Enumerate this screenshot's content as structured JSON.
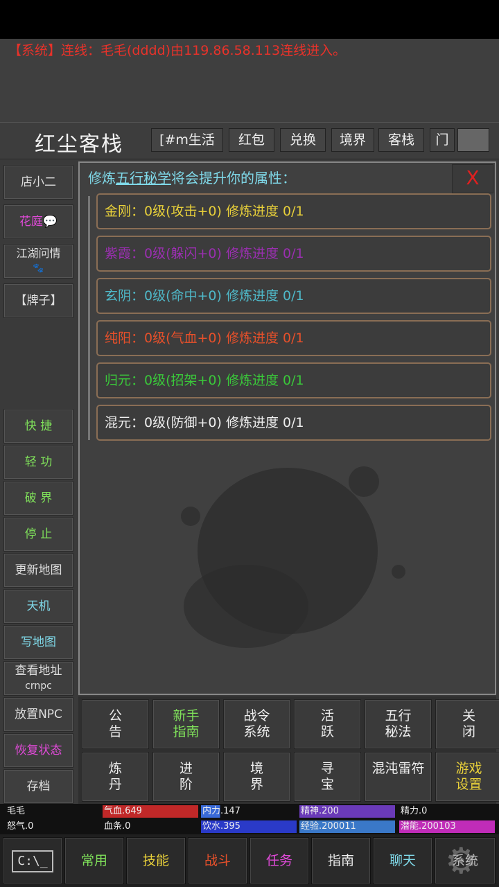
{
  "system_message": "【系统】连线：毛毛(dddd)由119.86.58.113连线进入。",
  "room": {
    "name": "红尘客栈",
    "buttons": [
      "[#m生活",
      "红包",
      "兑换",
      "境界",
      "客栈",
      "门"
    ]
  },
  "left_menu_top": [
    {
      "label": "店小二",
      "sub": "",
      "color": "#dddddd"
    },
    {
      "label": "花庭💬",
      "sub": "",
      "color": "#e04ad8"
    },
    {
      "label": "江湖问情",
      "sub": "🐾",
      "color": "#dddddd"
    },
    {
      "label": "【牌子】",
      "sub": "",
      "color": "#dddddd"
    }
  ],
  "left_menu_bottom": [
    {
      "label": "快 捷",
      "sub": "",
      "color": "#7fe05a"
    },
    {
      "label": "轻 功",
      "sub": "",
      "color": "#7fe05a"
    },
    {
      "label": "破 界",
      "sub": "",
      "color": "#7fe05a"
    },
    {
      "label": "停 止",
      "sub": "",
      "color": "#7fe05a"
    },
    {
      "label": "更新地图",
      "sub": "",
      "color": "#dddddd"
    },
    {
      "label": "天机",
      "sub": "",
      "color": "#7fd8e8"
    },
    {
      "label": "写地图",
      "sub": "",
      "color": "#7fd8e8"
    },
    {
      "label": "查看地址",
      "sub": "crnpc",
      "color": "#dddddd"
    },
    {
      "label": "放置NPC",
      "sub": "",
      "color": "#dddddd"
    },
    {
      "label": "恢复状态",
      "sub": "",
      "color": "#e04ad8"
    },
    {
      "label": "存档",
      "sub": "",
      "color": "#dddddd"
    }
  ],
  "panel": {
    "title_prefix": "修炼",
    "title_link": "五行秘学",
    "title_suffix": "将会提升你的属性：",
    "close_label": "X",
    "rows": [
      {
        "text": "金刚：0级(攻击+0)  修炼进度 0/1",
        "color": "#e8d03a"
      },
      {
        "text": "紫霞：0级(躲闪+0)  修炼进度 0/1",
        "color": "#9a2fb0"
      },
      {
        "text": "玄阴：0级(命中+0)  修炼进度 0/1",
        "color": "#4fb8c8"
      },
      {
        "text": "纯阳：0级(气血+0)  修炼进度 0/1",
        "color": "#e8502a"
      },
      {
        "text": "归元：0级(招架+0)  修炼进度 0/1",
        "color": "#3ac83a"
      },
      {
        "text": "混元：0级(防御+0)  修炼进度 0/1",
        "color": "#eeeeee"
      }
    ]
  },
  "menu_grid": [
    {
      "label": "公\n告",
      "color": "#eeeeee"
    },
    {
      "label": "新手\n指南",
      "color": "#7fe05a"
    },
    {
      "label": "战令\n系统",
      "color": "#eeeeee"
    },
    {
      "label": "活\n跃",
      "color": "#eeeeee"
    },
    {
      "label": "五行\n秘法",
      "color": "#eeeeee"
    },
    {
      "label": "关\n闭",
      "color": "#eeeeee"
    },
    {
      "label": "炼\n丹",
      "color": "#eeeeee"
    },
    {
      "label": "进\n阶",
      "color": "#eeeeee"
    },
    {
      "label": "境\n界",
      "color": "#eeeeee"
    },
    {
      "label": "寻\n宝",
      "color": "#eeeeee"
    },
    {
      "label": "混沌雷符",
      "color": "#eeeeee"
    },
    {
      "label": "游戏\n设置",
      "color": "#e8d03a"
    }
  ],
  "stats": {
    "name": "毛毛",
    "anger": "怒气.0",
    "hp_bar": "血条.0",
    "qixue": "气血.649",
    "neili": "内力.147",
    "jingshen": "精神.200",
    "jingli": "精力.0",
    "yinshui": "饮水.395",
    "jingyan": "经验.200011",
    "qianneng": "潜能.200103",
    "neili_fill": 0.2,
    "colors": {
      "qixue": "#c02828",
      "neili": "#3a6ad8",
      "jingshen": "#6a3ab8",
      "yinshui": "#2a3ac8",
      "jingyan": "#3a78c8",
      "qianneng": "#c02cb8"
    }
  },
  "bottom_nav": [
    {
      "label": "C:\\_",
      "color": "#dddddd"
    },
    {
      "label": "常用",
      "color": "#7fe05a"
    },
    {
      "label": "技能",
      "color": "#e8d03a"
    },
    {
      "label": "战斗",
      "color": "#e8502a"
    },
    {
      "label": "任务",
      "color": "#e04ad8"
    },
    {
      "label": "指南",
      "color": "#eeeeee"
    },
    {
      "label": "聊天",
      "color": "#7fd8e8"
    },
    {
      "label": "系统",
      "color": "#cccccc"
    }
  ]
}
